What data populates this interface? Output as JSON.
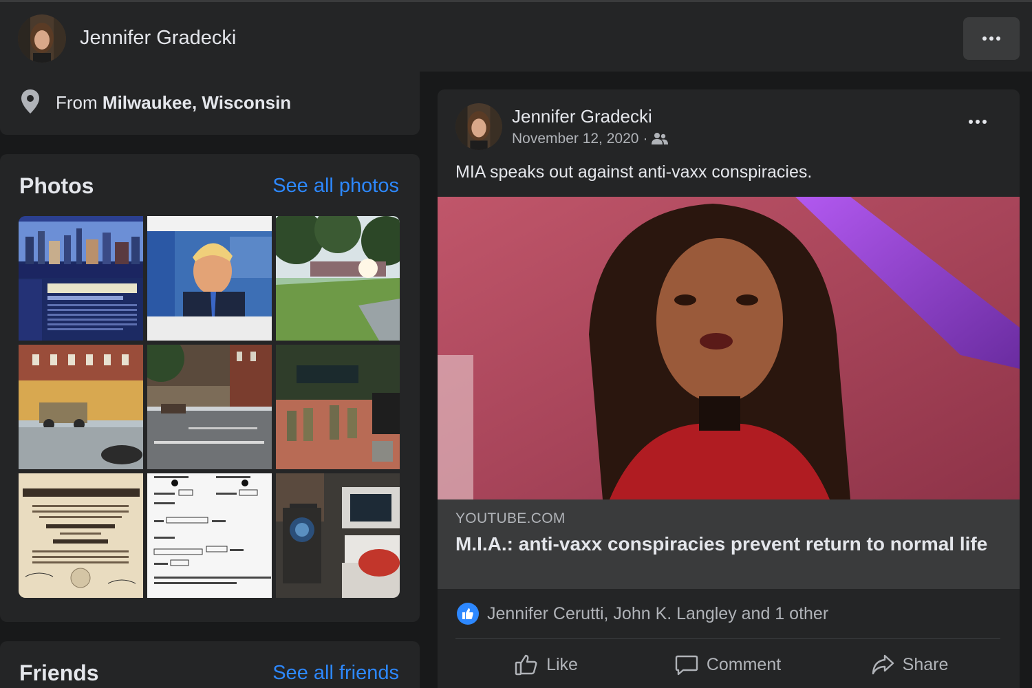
{
  "header": {
    "profile_name": "Jennifer Gradecki"
  },
  "intro": {
    "from_prefix": "From",
    "location": "Milwaukee, Wisconsin"
  },
  "photos": {
    "title": "Photos",
    "see_all": "See all photos"
  },
  "friends": {
    "title": "Friends",
    "see_all": "See all friends"
  },
  "post": {
    "author": "Jennifer Gradecki",
    "date": "November 12, 2020",
    "date_suffix": "·",
    "audience_icon": "friends-icon",
    "text": "MIA speaks out against anti-vaxx conspiracies.",
    "link": {
      "domain": "YOUTUBE.COM",
      "title": "M.I.A.: anti-vaxx conspiracies prevent return to normal life"
    },
    "reactions": {
      "names": "Jennifer Cerutti, John K. Langley and 1 other"
    },
    "actions": {
      "like": "Like",
      "comment": "Comment",
      "share": "Share"
    }
  },
  "colors": {
    "background": "#18191a",
    "card": "#242526",
    "link_box": "#3a3b3c",
    "accent": "#2d88ff",
    "text_primary": "#e4e6eb",
    "text_secondary": "#b0b3b8"
  }
}
